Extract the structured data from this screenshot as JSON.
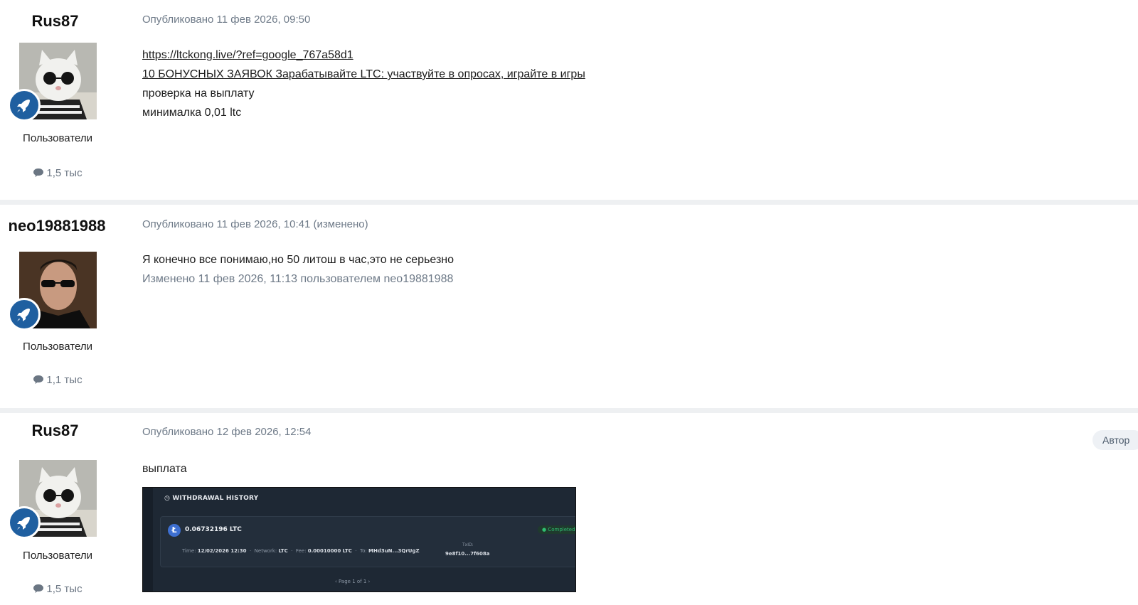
{
  "posts": [
    {
      "author": "Rus87",
      "group": "Пользователи",
      "post_count": "1,5 тыс",
      "meta": "Опубликовано 11 фев 2026, 09:50",
      "lines": [
        "https://ltckong.live/?ref=google_767a58d1",
        "10 БОНУСНЫХ ЗАЯВОК Зарабатывайте LTC: участвуйте в опросах, играйте в игры",
        "проверка на выплату",
        "минималка 0,01 ltc"
      ]
    },
    {
      "author": "neo19881988",
      "group": "Пользователи",
      "post_count": "1,1 тыс",
      "meta": "Опубликовано 11 фев 2026, 10:41 (изменено)",
      "lines": [
        "Я конечно все понимаю,но 50 литош в час,это не серьезно"
      ],
      "edited_note": "Изменено 11 фев 2026, 11:13 пользователем neo19881988"
    },
    {
      "author": "Rus87",
      "group": "Пользователи",
      "post_count": "1,5 тыс",
      "meta": "Опубликовано 12 фев 2026, 12:54",
      "badge": "Автор",
      "lines": [
        "выплата"
      ]
    }
  ],
  "screenshot": {
    "header": "WITHDRAWAL HISTORY",
    "amount": "0.06732196 LTC",
    "status": "● Completed",
    "time_label": "Time:",
    "time_value": "12/02/2026 12:30",
    "network_label": "Network:",
    "network_value": "LTC",
    "fee_label": "Fee:",
    "fee_value": "0.00010000 LTC",
    "to_label": "To:",
    "to_value": "MHd3uN...3QrUgZ",
    "txid_label": "TxID:",
    "txid_value": "9e8f10...7f608a",
    "pager": "‹   Page 1 of 1   ›"
  },
  "icons": {
    "rank_badge": "rocket-icon",
    "post_count": "comment-icon"
  },
  "colors": {
    "rank_badge_bg": "#1f5fa0",
    "meta_text": "#6e7a88",
    "separator": "#eef0f2"
  }
}
